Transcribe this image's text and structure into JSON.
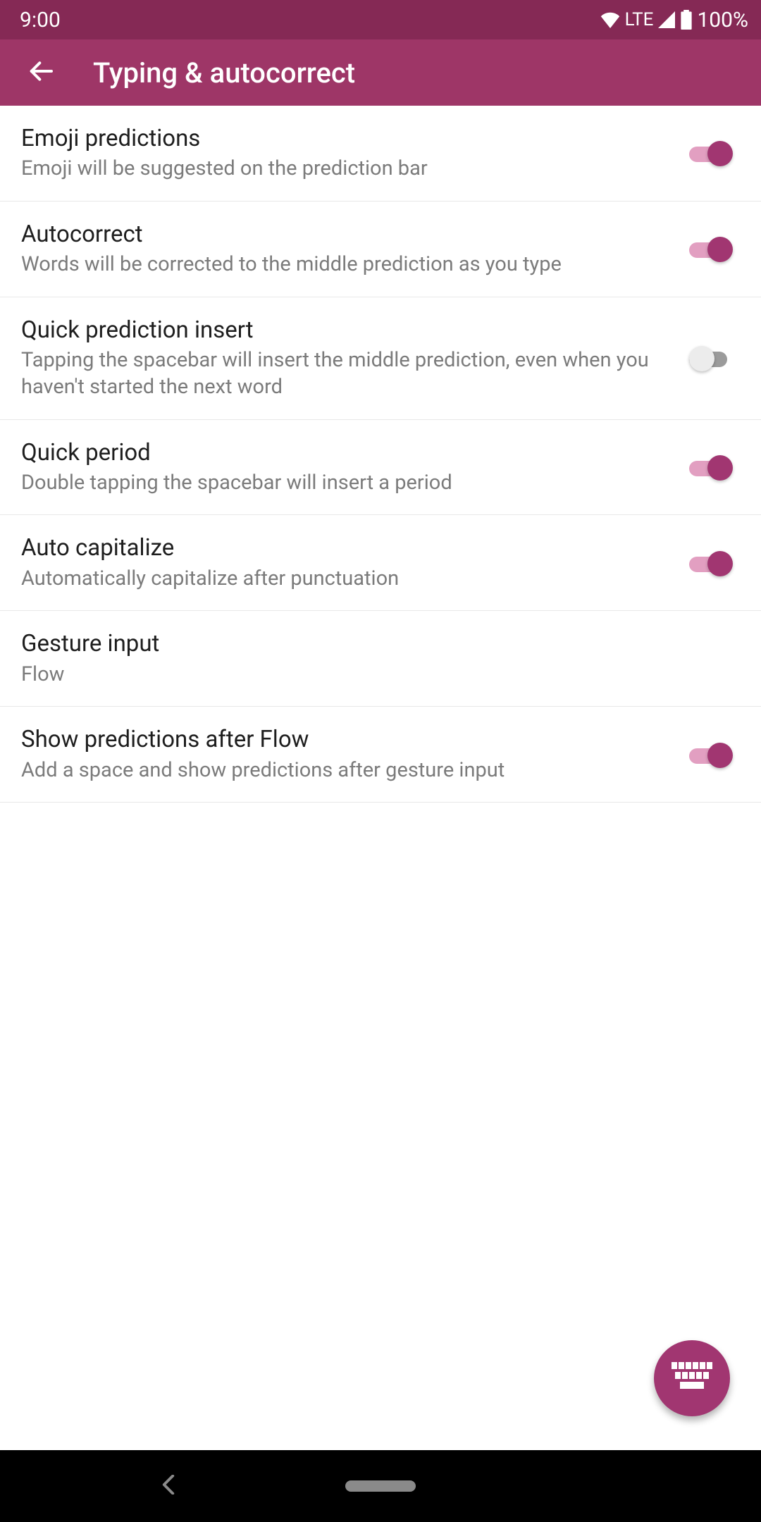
{
  "colors": {
    "accent": "#a13671",
    "status_bg": "#852955",
    "appbar_bg": "#9e3667",
    "track_on": "#e29fc1"
  },
  "status": {
    "time": "9:00",
    "network_label": "LTE",
    "battery": "100%"
  },
  "header": {
    "title": "Typing & autocorrect"
  },
  "settings": [
    {
      "id": "emoji-predictions",
      "title": "Emoji predictions",
      "subtitle": "Emoji will be suggested on the prediction bar",
      "toggle": true,
      "value": true
    },
    {
      "id": "autocorrect",
      "title": "Autocorrect",
      "subtitle": "Words will be corrected to the middle prediction as you type",
      "toggle": true,
      "value": true
    },
    {
      "id": "quick-prediction-insert",
      "title": "Quick prediction insert",
      "subtitle": "Tapping the spacebar will insert the middle prediction, even when you haven't started the next word",
      "toggle": true,
      "value": false
    },
    {
      "id": "quick-period",
      "title": "Quick period",
      "subtitle": "Double tapping the spacebar will insert a period",
      "toggle": true,
      "value": true
    },
    {
      "id": "auto-capitalize",
      "title": "Auto capitalize",
      "subtitle": "Automatically capitalize after punctuation",
      "toggle": true,
      "value": true
    },
    {
      "id": "gesture-input",
      "title": "Gesture input",
      "subtitle": "Flow",
      "toggle": false
    },
    {
      "id": "show-predictions-after-flow",
      "title": "Show predictions after Flow",
      "subtitle": "Add a space and show predictions after gesture input",
      "toggle": true,
      "value": true
    }
  ]
}
